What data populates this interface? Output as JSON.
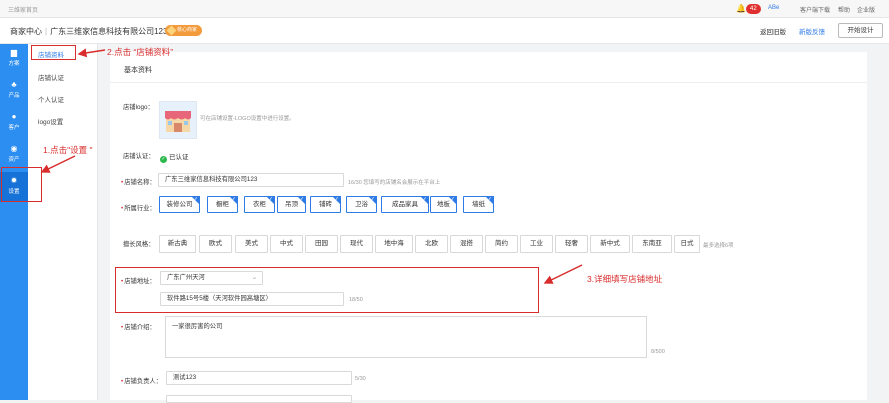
{
  "topbar": {
    "home_label": "三维家首页",
    "notification_count": "42",
    "mail_label": "ABe",
    "links": [
      "客户端下载",
      "帮助",
      "企业版"
    ]
  },
  "header": {
    "breadcrumb_home": "商家中心",
    "company_name": "广东三维家信息科技有限公司123",
    "vip_label": "核心商家",
    "back_label": "返回旧版",
    "feedback_label": "新版反馈",
    "design_label": "开始设计"
  },
  "sidebar": {
    "items": [
      {
        "label": "方案",
        "icon": "folder-icon"
      },
      {
        "label": "产品",
        "icon": "product-icon"
      },
      {
        "label": "客户",
        "icon": "user-icon"
      },
      {
        "label": "资产",
        "icon": "coin-icon"
      },
      {
        "label": "设置",
        "icon": "gear-icon"
      }
    ]
  },
  "subnav": {
    "items": [
      "店铺资料",
      "店铺认证",
      "个人认证",
      "logo设置"
    ]
  },
  "main": {
    "section_title": "基本资料",
    "logo_label": "店铺logo：",
    "logo_hint": "可在店铺设置-LOGO设置中进行设置。",
    "cert_label": "店铺认证：",
    "cert_value": "已认证",
    "name_label": "店铺名称：",
    "name_value": "广东三维家信息科技有限公司123",
    "name_hint": "16/30  您填写的店铺名会展示在平台上",
    "industry_label": "所属行业：",
    "industries": [
      "装修公司",
      "橱柜",
      "衣柜",
      "吊顶",
      "铺砖",
      "卫浴",
      "成品家具",
      "地板",
      "墙纸"
    ],
    "style_label": "擅长风格：",
    "styles": [
      "新古典",
      "欧式",
      "美式",
      "中式",
      "田园",
      "现代",
      "地中海",
      "北欧",
      "混搭",
      "简约",
      "工业",
      "轻奢",
      "新中式",
      "东南亚",
      "日式"
    ],
    "style_hint": "最多选择6项",
    "address_label": "店铺地址：",
    "address_region": "广东广州天河",
    "address_detail": "软件路15号5楼（天河软件园高塘区）",
    "address_count": "18/50",
    "intro_label": "店铺介绍：",
    "intro_value": "一家很厉害的公司",
    "intro_count": "8/500",
    "owner_label": "店铺负责人：",
    "owner_value": "测试123",
    "owner_count": "5/30"
  },
  "annotations": {
    "step1": "1.点击\"设置 \"",
    "step2": "2.点击 “店铺资料”",
    "step3": "3.详细填写店铺地址"
  },
  "colors": {
    "sidebar_blue": "#2b8ef0",
    "accent_blue": "#2f7be6",
    "annotation_red": "#d92c2c",
    "badge_red": "#e02f2f",
    "verified_green": "#2bb84a"
  }
}
